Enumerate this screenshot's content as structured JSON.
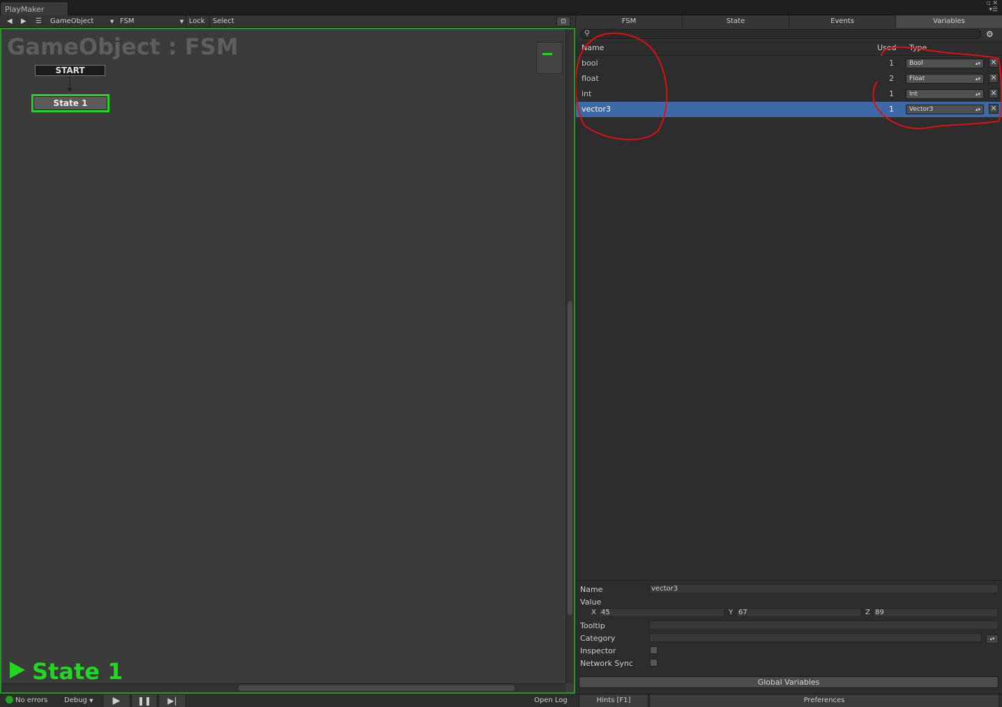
{
  "window": {
    "tab_title": "PlayMaker"
  },
  "graph_toolbar": {
    "back_icon": "back-arrow-icon",
    "forward_icon": "forward-arrow-icon",
    "gameobject": "GameObject",
    "fsm": "FSM",
    "lock": "Lock",
    "select": "Select"
  },
  "graph": {
    "title": "GameObject : FSM",
    "start_node": "START",
    "state_node": "State 1",
    "active_state": "State 1"
  },
  "panel": {
    "tabs": [
      {
        "label": "FSM"
      },
      {
        "label": "State"
      },
      {
        "label": "Events"
      },
      {
        "label": "Variables"
      }
    ],
    "active_tab": "Variables",
    "columns": {
      "name": "Name",
      "used": "Used",
      "type": "Type"
    },
    "variables": [
      {
        "name": "bool",
        "used": "1",
        "type": "Bool"
      },
      {
        "name": "float",
        "used": "2",
        "type": "Float"
      },
      {
        "name": "int",
        "used": "1",
        "type": "Int"
      },
      {
        "name": "vector3",
        "used": "1",
        "type": "Vector3"
      }
    ],
    "selected_variable": "vector3"
  },
  "details": {
    "name_label": "Name",
    "name_value": "vector3",
    "value_label": "Value",
    "x_label": "X",
    "x_value": "45",
    "y_label": "Y",
    "y_value": "67",
    "z_label": "Z",
    "z_value": "89",
    "tooltip_label": "Tooltip",
    "category_label": "Category",
    "inspector_label": "Inspector",
    "network_sync_label": "Network Sync",
    "global_button": "Global Variables"
  },
  "bottom_bar": {
    "status": "No errors",
    "debug": "Debug",
    "open_log": "Open Log",
    "hints": "Hints [F1]",
    "preferences": "Preferences"
  },
  "colors": {
    "accent_green": "#22d622",
    "selection_blue": "#3d6aa6",
    "annotation_red": "#e01010"
  }
}
